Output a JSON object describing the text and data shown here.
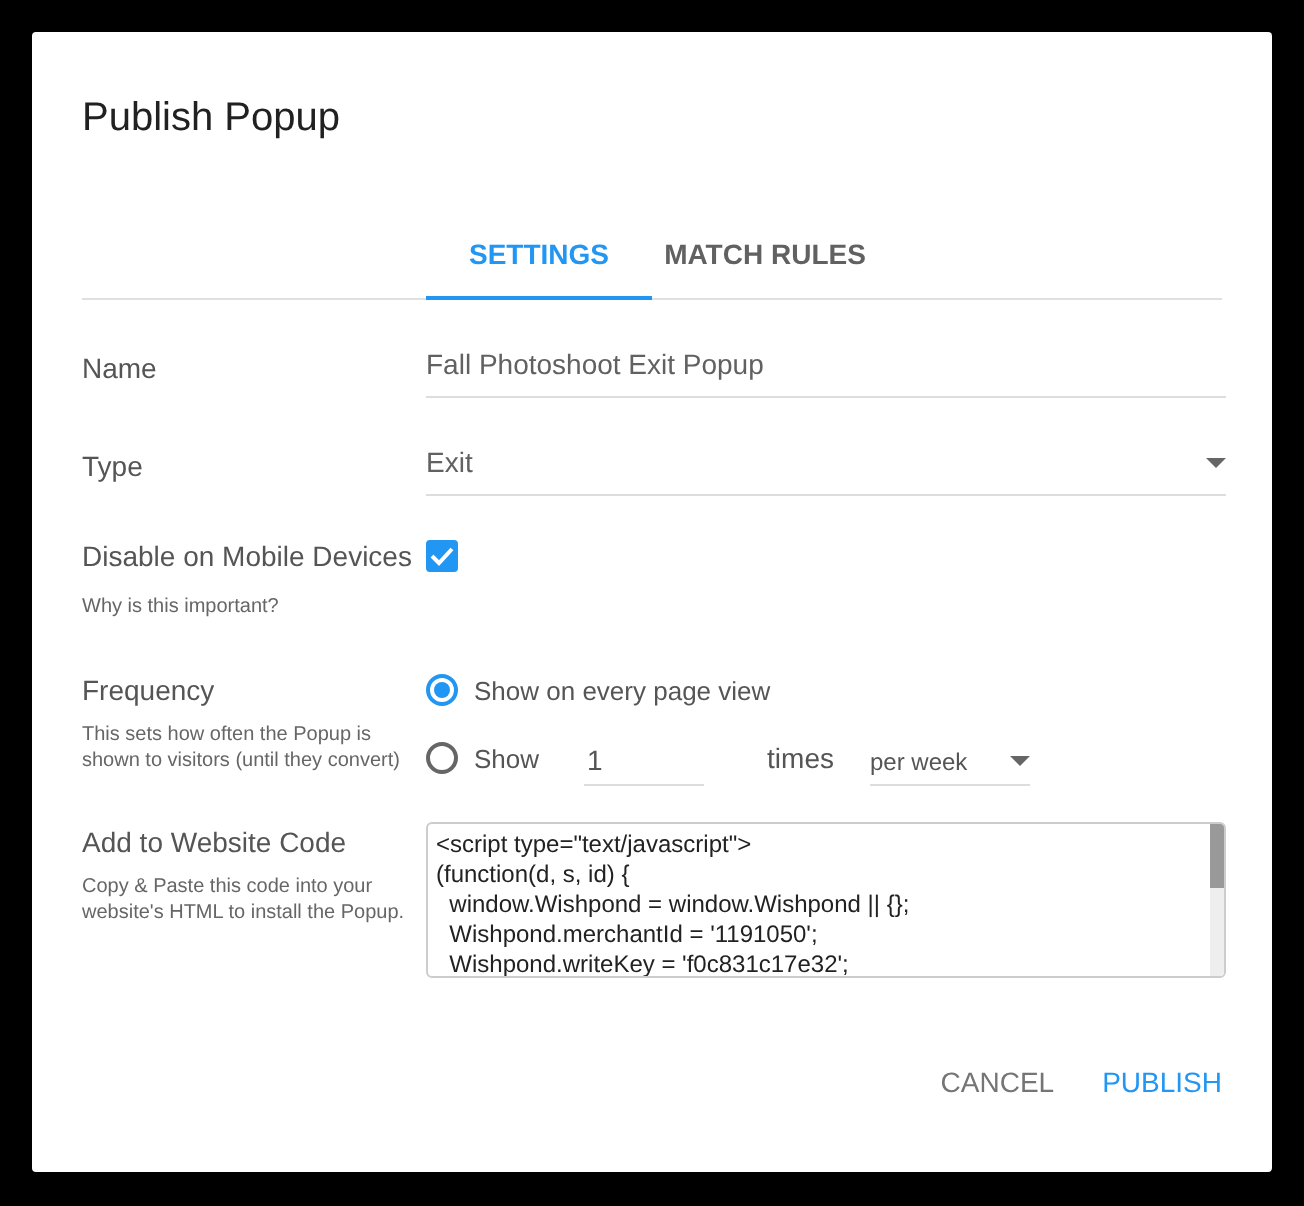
{
  "dialog": {
    "title": "Publish Popup"
  },
  "tabs": [
    {
      "label": "SETTINGS",
      "selected": true
    },
    {
      "label": "MATCH RULES",
      "selected": false
    }
  ],
  "name_field": {
    "label": "Name",
    "value": "Fall Photoshoot Exit Popup"
  },
  "type_field": {
    "label": "Type",
    "value": "Exit"
  },
  "disable_mobile": {
    "label": "Disable on Mobile Devices",
    "help_link": "Why is this important?",
    "checked": true
  },
  "frequency": {
    "label": "Frequency",
    "description": "This sets how often the Popup is shown to visitors (until they convert)",
    "options": [
      {
        "kind": "plain",
        "label": "Show on every page view",
        "selected": true
      },
      {
        "kind": "limited",
        "label": "Show",
        "count": "1",
        "unit": "times",
        "period": "per week",
        "selected": false
      }
    ]
  },
  "website_code": {
    "label": "Add to Website Code",
    "description": "Copy & Paste this code into your website's HTML to install the Popup.",
    "lines": [
      "<script type=\"text/javascript\">",
      "(function(d, s, id) {",
      "  window.Wishpond = window.Wishpond || {};",
      "  Wishpond.merchantId = '1191050';",
      "  Wishpond.writeKey = 'f0c831c17e32';"
    ]
  },
  "buttons": [
    {
      "label": "CANCEL",
      "kind": "secondary"
    },
    {
      "label": "PUBLISH",
      "kind": "primary"
    }
  ]
}
